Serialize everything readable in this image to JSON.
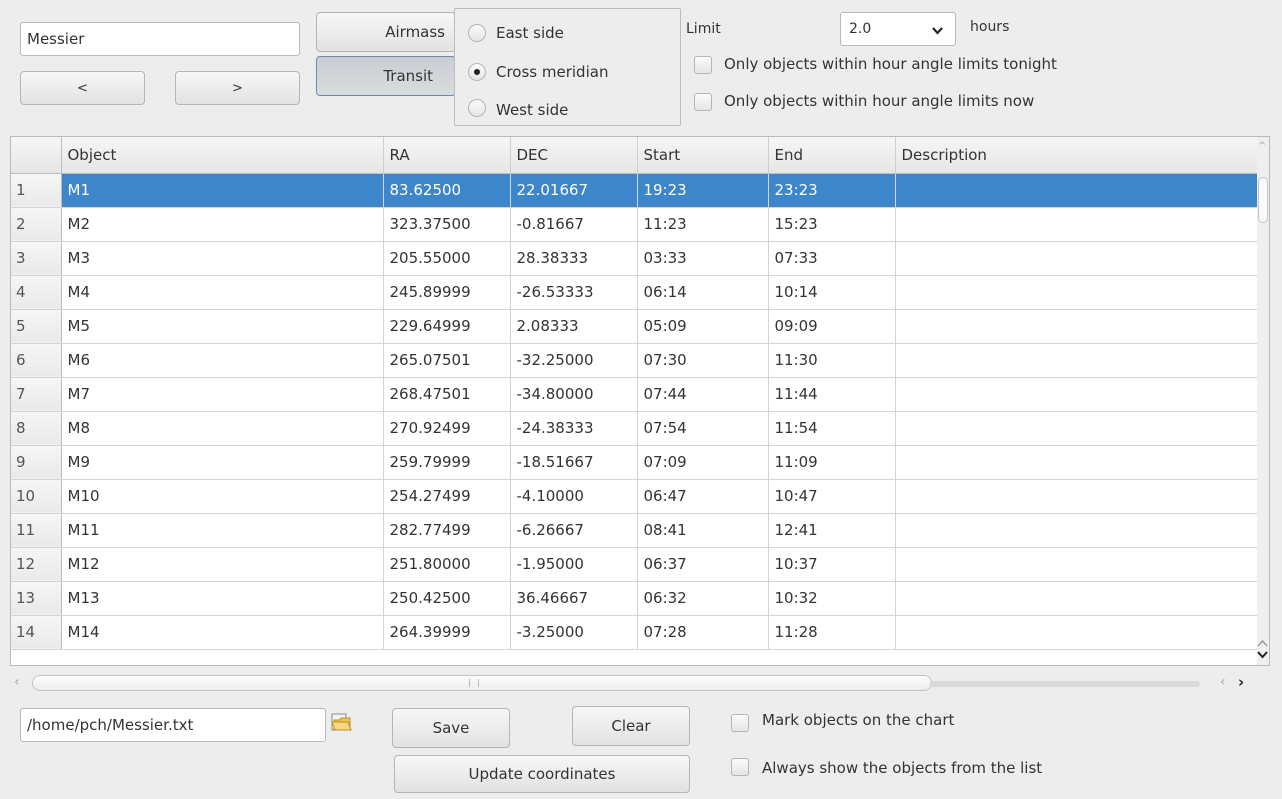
{
  "top": {
    "catalog_value": "Messier",
    "airmass_label": "Airmass",
    "transit_label": "Transit",
    "prev_label": "<",
    "next_label": ">",
    "east_side_label": "East side",
    "cross_meridian_label": "Cross meridian",
    "west_side_label": "West side",
    "selected_side": "Cross meridian",
    "limit_label": "Limit",
    "limit_value": "2.0",
    "hours_label": "hours",
    "check_tonight_label": "Only objects within hour angle limits tonight",
    "check_now_label": "Only objects within hour angle limits now"
  },
  "table": {
    "columns": [
      "Object",
      "RA",
      "DEC",
      "Start",
      "End",
      "Description"
    ],
    "rows": [
      {
        "num": "1",
        "object": "M1",
        "ra": "83.62500",
        "dec": "22.01667",
        "start": "19:23",
        "end": "23:23",
        "description": ""
      },
      {
        "num": "2",
        "object": "M2",
        "ra": "323.37500",
        "dec": "-0.81667",
        "start": "11:23",
        "end": "15:23",
        "description": ""
      },
      {
        "num": "3",
        "object": "M3",
        "ra": "205.55000",
        "dec": "28.38333",
        "start": "03:33",
        "end": "07:33",
        "description": ""
      },
      {
        "num": "4",
        "object": "M4",
        "ra": "245.89999",
        "dec": "-26.53333",
        "start": "06:14",
        "end": "10:14",
        "description": ""
      },
      {
        "num": "5",
        "object": "M5",
        "ra": "229.64999",
        "dec": "2.08333",
        "start": "05:09",
        "end": "09:09",
        "description": ""
      },
      {
        "num": "6",
        "object": "M6",
        "ra": "265.07501",
        "dec": "-32.25000",
        "start": "07:30",
        "end": "11:30",
        "description": ""
      },
      {
        "num": "7",
        "object": "M7",
        "ra": "268.47501",
        "dec": "-34.80000",
        "start": "07:44",
        "end": "11:44",
        "description": ""
      },
      {
        "num": "8",
        "object": "M8",
        "ra": "270.92499",
        "dec": "-24.38333",
        "start": "07:54",
        "end": "11:54",
        "description": ""
      },
      {
        "num": "9",
        "object": "M9",
        "ra": "259.79999",
        "dec": "-18.51667",
        "start": "07:09",
        "end": "11:09",
        "description": ""
      },
      {
        "num": "10",
        "object": "M10",
        "ra": "254.27499",
        "dec": "-4.10000",
        "start": "06:47",
        "end": "10:47",
        "description": ""
      },
      {
        "num": "11",
        "object": "M11",
        "ra": "282.77499",
        "dec": "-6.26667",
        "start": "08:41",
        "end": "12:41",
        "description": ""
      },
      {
        "num": "12",
        "object": "M12",
        "ra": "251.80000",
        "dec": "-1.95000",
        "start": "06:37",
        "end": "10:37",
        "description": ""
      },
      {
        "num": "13",
        "object": "M13",
        "ra": "250.42500",
        "dec": "36.46667",
        "start": "06:32",
        "end": "10:32",
        "description": ""
      },
      {
        "num": "14",
        "object": "M14",
        "ra": "264.39999",
        "dec": "-3.25000",
        "start": "07:28",
        "end": "11:28",
        "description": ""
      }
    ],
    "selected_row": "1"
  },
  "bottom": {
    "file_path": "/home/pch/Messier.txt",
    "save_label": "Save",
    "clear_label": "Clear",
    "update_label": "Update coordinates",
    "mark_objects_label": "Mark objects on the chart",
    "always_show_label": "Always show the objects from the list"
  },
  "colors": {
    "selection": "#3d86c9",
    "window_bg": "#ededed"
  }
}
